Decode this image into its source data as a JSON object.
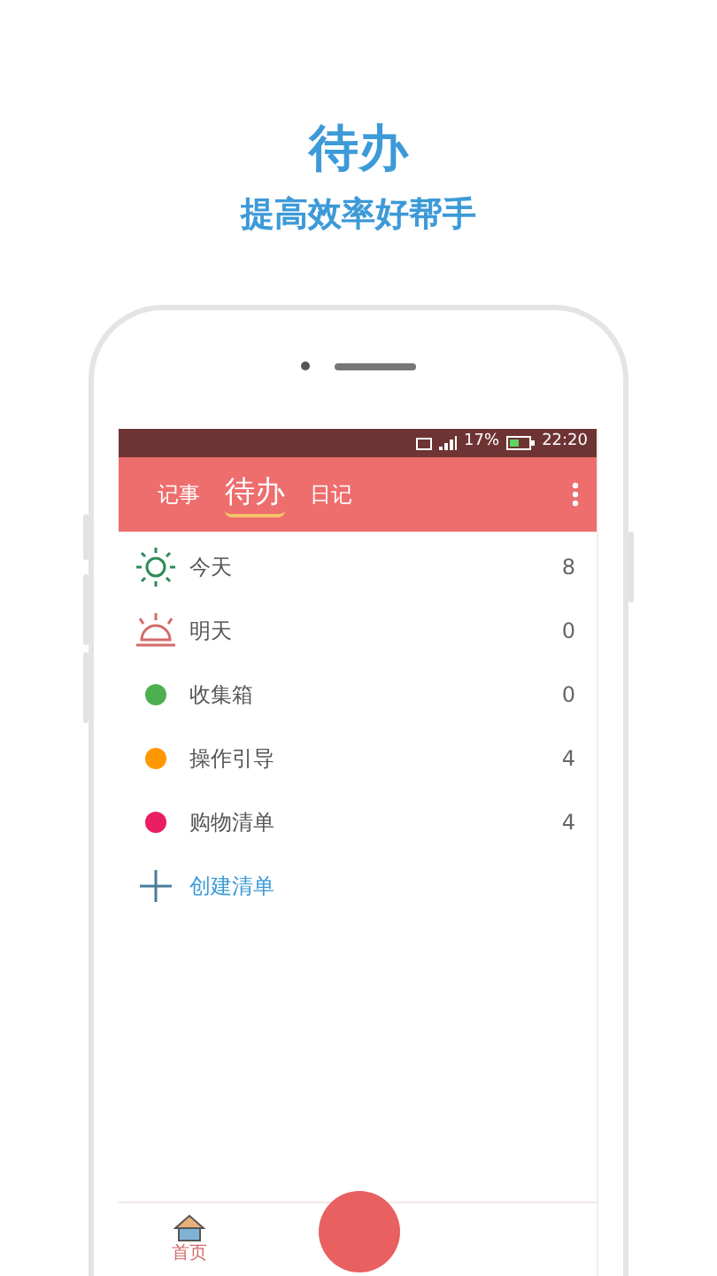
{
  "header": {
    "title": "待办",
    "subtitle": "提高效率好帮手"
  },
  "status_bar": {
    "battery": "17%",
    "time": "22:20"
  },
  "tabs": [
    {
      "label": "记事",
      "selected": false
    },
    {
      "label": "待办",
      "selected": true
    },
    {
      "label": "日记",
      "selected": false
    }
  ],
  "lists": [
    {
      "kind": "today",
      "label": "今天",
      "count": "8"
    },
    {
      "kind": "tomorrow",
      "label": "明天",
      "count": "0"
    },
    {
      "kind": "dot",
      "color": "#4caf50",
      "label": "收集箱",
      "count": "0"
    },
    {
      "kind": "dot",
      "color": "#ff9800",
      "label": "操作引导",
      "count": "4"
    },
    {
      "kind": "dot",
      "color": "#e91e63",
      "label": "购物清单",
      "count": "4"
    }
  ],
  "create": {
    "label": "创建清单"
  },
  "bottom_nav": [
    {
      "label": "首页",
      "selected": true
    }
  ]
}
